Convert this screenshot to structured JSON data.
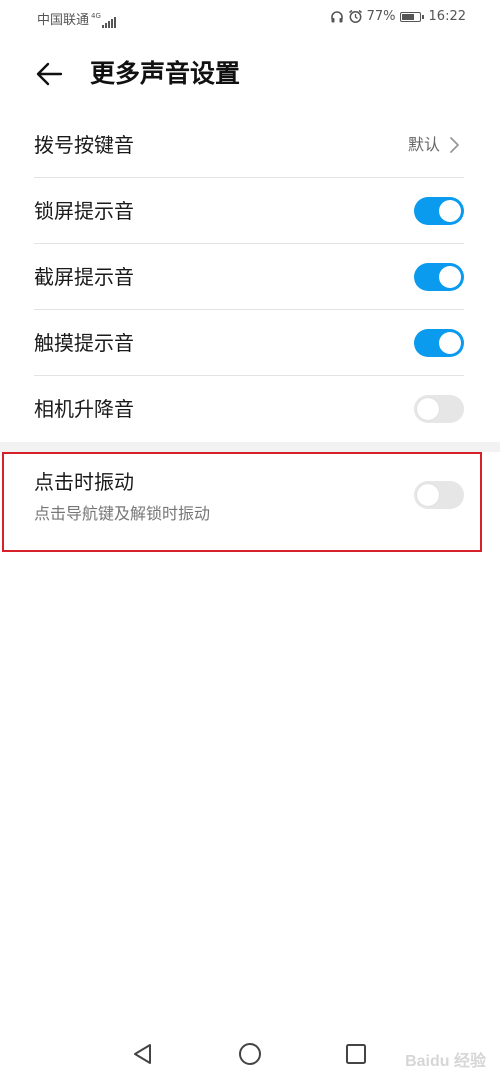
{
  "status_bar": {
    "carrier": "中国联通",
    "network_type": "4G",
    "battery_percent": "77%",
    "time": "16:22",
    "battery_level": 0.77
  },
  "header": {
    "title": "更多声音设置"
  },
  "settings": {
    "dial_tone": {
      "label": "拨号按键音",
      "value": "默认"
    },
    "lock_sound": {
      "label": "锁屏提示音",
      "enabled": true
    },
    "screenshot_sound": {
      "label": "截屏提示音",
      "enabled": true
    },
    "touch_sound": {
      "label": "触摸提示音",
      "enabled": true
    },
    "camera_lift_sound": {
      "label": "相机升降音",
      "enabled": false
    },
    "tap_vibration": {
      "label": "点击时振动",
      "description": "点击导航键及解锁时振动",
      "enabled": false
    }
  },
  "watermark": "Baidu 经验",
  "colors": {
    "toggle_on": "#0a9bee",
    "toggle_off": "#e6e6e6",
    "highlight": "#d6212a"
  },
  "icons": [
    "back-arrow-icon",
    "chevron-right-icon",
    "headset-icon",
    "alarm-icon",
    "battery-icon",
    "signal-icon",
    "nav-back-icon",
    "nav-home-icon",
    "nav-recents-icon"
  ]
}
